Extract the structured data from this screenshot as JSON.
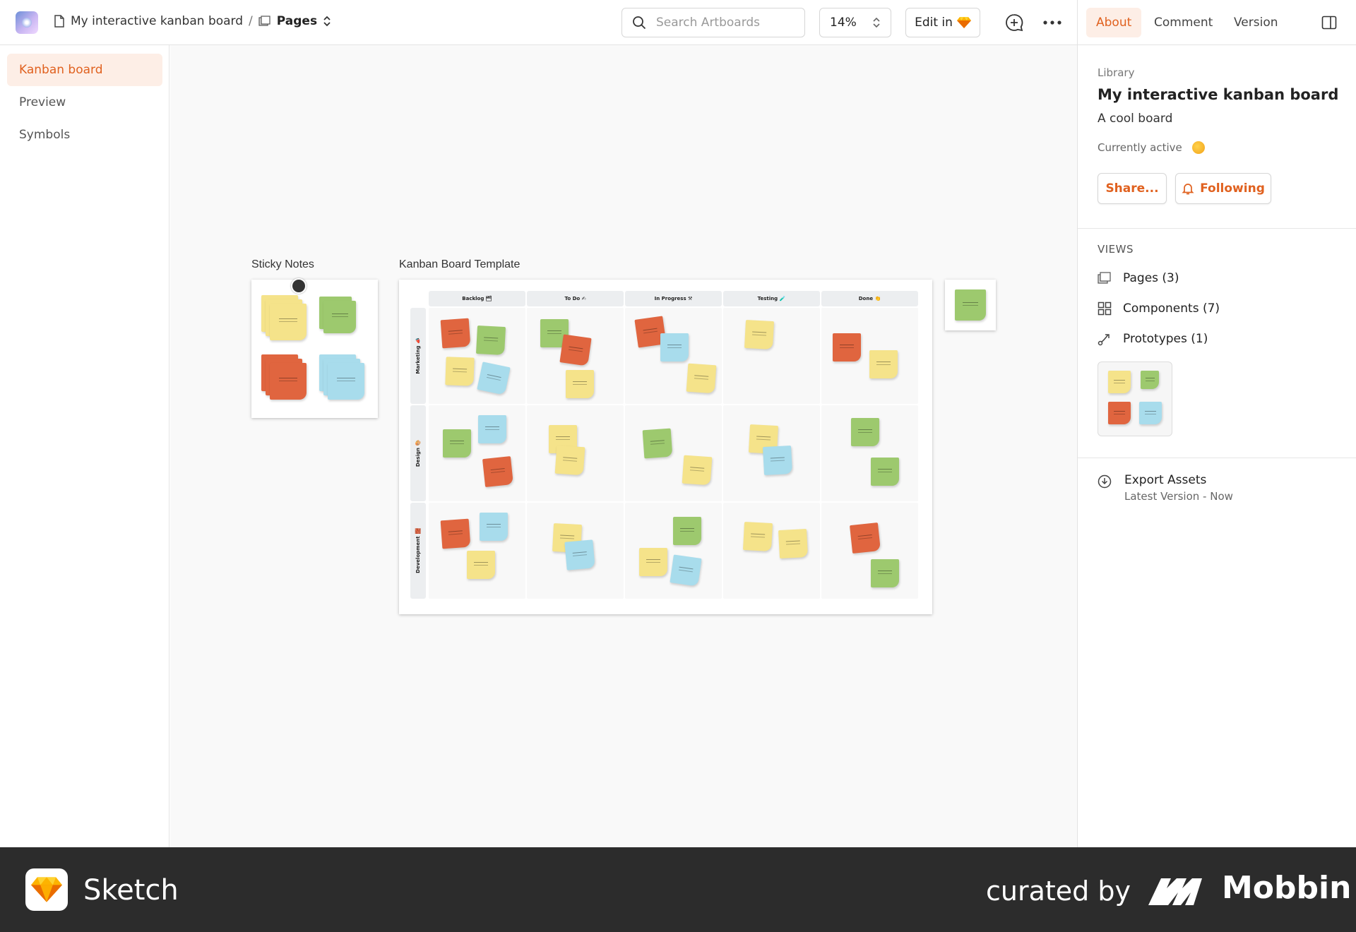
{
  "app": {
    "doc_title": "My interactive kanban board",
    "breadcrumb_sep": "/",
    "pages_label": "Pages",
    "search_placeholder": "Search Artboards",
    "zoom": "14%",
    "edit_in": "Edit in"
  },
  "sidebar": {
    "items": [
      {
        "label": "Kanban board",
        "active": true
      },
      {
        "label": "Preview",
        "active": false
      },
      {
        "label": "Symbols",
        "active": false
      }
    ]
  },
  "canvas": {
    "artboards": {
      "sticky": "Sticky Notes",
      "kanban": "Kanban Board Template"
    },
    "kanban": {
      "columns": [
        "Backlog 🗂",
        "To Do ✍",
        "In Progress ⚒",
        "Testing 🧪",
        "Done 👏"
      ],
      "rows": [
        "Marketing 📣",
        "Design 🎨",
        "Development 🧱"
      ]
    }
  },
  "right_panel": {
    "tabs": [
      "About",
      "Comment",
      "Version"
    ],
    "library_label": "Library",
    "title": "My interactive kanban board",
    "description": "A cool board",
    "currently_active": "Currently active",
    "share_label": "Share...",
    "following_label": "Following",
    "views_label": "VIEWS",
    "views": [
      {
        "label": "Pages (3)",
        "icon": "pages-icon"
      },
      {
        "label": "Components (7)",
        "icon": "components-icon"
      },
      {
        "label": "Prototypes (1)",
        "icon": "prototypes-icon"
      }
    ],
    "export_title": "Export Assets",
    "export_sub": "Latest Version - Now"
  },
  "footer": {
    "brand": "Sketch",
    "curated_by": "curated by",
    "curator": "Mobbin"
  },
  "colors": {
    "accent": "#e0611f",
    "accent_bg": "#fdeee6",
    "note_yellow": "#f5e38a",
    "note_green": "#9dc96e",
    "note_red": "#e0653f",
    "note_blue": "#a8dcec"
  }
}
